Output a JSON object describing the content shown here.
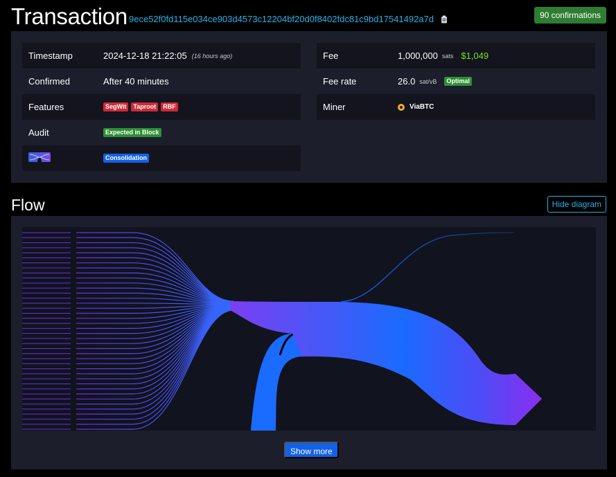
{
  "header": {
    "title": "Transaction",
    "txid": "9ece52f0fd115e034ce903d4573c12204bf20d0f8402fdc81c9bd17541492a7d",
    "confirmations": "90 confirmations"
  },
  "details": {
    "timestamp_label": "Timestamp",
    "timestamp_value": "2024-12-18 21:22:05",
    "timestamp_ago": "(16 hours ago)",
    "confirmed_label": "Confirmed",
    "confirmed_value": "After 40 minutes",
    "features_label": "Features",
    "features": [
      "SegWit",
      "Taproot",
      "RBF"
    ],
    "audit_label": "Audit",
    "audit_value": "Expected in Block",
    "consolidation_tag": "Consolidation",
    "fee_label": "Fee",
    "fee_value": "1,000,000",
    "fee_unit": "sats",
    "fee_usd": "$1,049",
    "feerate_label": "Fee rate",
    "feerate_value": "26.0",
    "feerate_unit": "sat/vB",
    "feerate_tag": "Optimal",
    "miner_label": "Miner",
    "miner_value": "ViaBTC"
  },
  "flow": {
    "title": "Flow",
    "hide_label": "Hide diagram",
    "show_more_label": "Show more",
    "input_count": 40
  },
  "colors": {
    "accent": "#28b2e6",
    "success": "#2e7d32",
    "danger": "#cf2a36",
    "primary": "#1162e8",
    "usd": "#7ae21c",
    "flow_start": "#7b3ff2",
    "flow_end": "#1a6bff"
  }
}
